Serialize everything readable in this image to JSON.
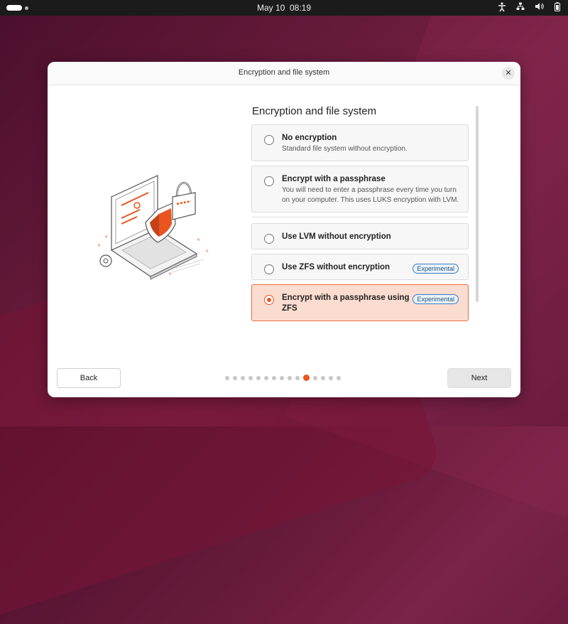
{
  "topbar": {
    "date": "May 10",
    "time": "08:19"
  },
  "dialog": {
    "window_title": "Encryption and file system",
    "close_glyph": "✕",
    "heading": "Encryption and file system",
    "options": [
      {
        "title": "No encryption",
        "description": "Standard file system without encryption.",
        "badge": "",
        "selected": false
      },
      {
        "title": "Encrypt with a passphrase",
        "description": "You will need to enter a passphrase every time you turn on your computer. This uses LUKS encryption with LVM.",
        "badge": "",
        "selected": false
      },
      {
        "title": "Use LVM without encryption",
        "description": "",
        "badge": "",
        "selected": false
      },
      {
        "title": "Use ZFS without encryption",
        "description": "",
        "badge": "Experimental",
        "selected": false
      },
      {
        "title": "Encrypt with a passphrase using ZFS",
        "description": "",
        "badge": "Experimental",
        "selected": true
      }
    ],
    "back_label": "Back",
    "next_label": "Next",
    "progress": {
      "total": 15,
      "current": 11
    }
  },
  "colors": {
    "accent": "#e95420",
    "selected_bg": "#fbdcd0",
    "badge_blue": "#3a7cc0"
  },
  "icons": [
    "accessibility-icon",
    "network-icon",
    "volume-icon",
    "battery-icon",
    "close-icon",
    "laptop-lock-illustration"
  ]
}
